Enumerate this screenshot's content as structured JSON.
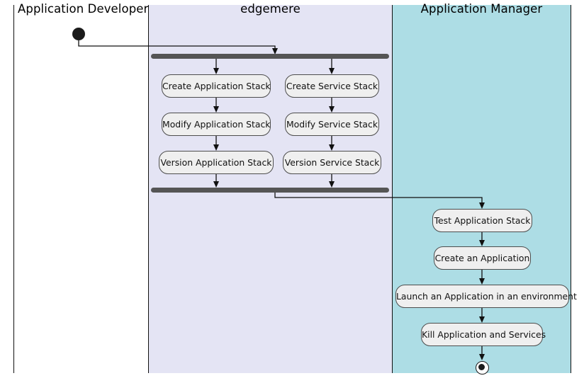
{
  "diagram": {
    "type": "uml-activity-diagram",
    "title": "edgemere application lifecycle activity diagram",
    "colors": {
      "lane_developer_bg": "#ffffff",
      "lane_edgemere_bg": "#e4e4f4",
      "lane_manager_bg": "#addde5",
      "activity_bg": "#efefef",
      "activity_border": "#4d4d4d",
      "bar_fill": "#555555",
      "line": "#111111",
      "node_fill": "#1b1b1b"
    }
  },
  "lanes": [
    {
      "id": "developer",
      "title": "Application Developer"
    },
    {
      "id": "edgemere",
      "title": "edgemere"
    },
    {
      "id": "manager",
      "title": "Application Manager"
    }
  ],
  "nodes": {
    "initial": {
      "label": "initial-node",
      "lane": "developer"
    },
    "fork": {
      "label": "fork-bar",
      "lane": "edgemere"
    },
    "join": {
      "label": "join-bar",
      "lane": "edgemere"
    },
    "final": {
      "label": "final-node",
      "lane": "manager"
    }
  },
  "activities": {
    "edgemere_left": [
      {
        "label": "Create Application Stack"
      },
      {
        "label": "Modify Application Stack"
      },
      {
        "label": "Version Application Stack"
      }
    ],
    "edgemere_right": [
      {
        "label": "Create Service Stack"
      },
      {
        "label": "Modify Service Stack"
      },
      {
        "label": "Version Service Stack"
      }
    ],
    "manager": [
      {
        "label": "Test Application Stack"
      },
      {
        "label": "Create an Application"
      },
      {
        "label": "Launch an Application in an environment"
      },
      {
        "label": "Kill Application and Services"
      }
    ]
  }
}
